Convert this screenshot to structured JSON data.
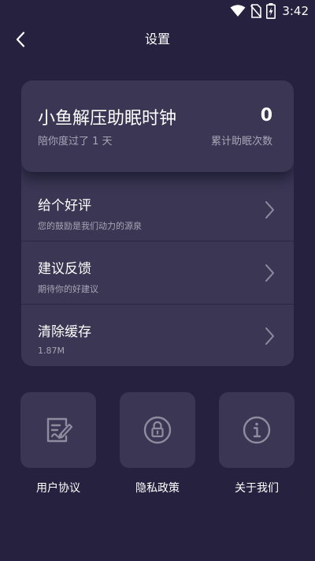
{
  "status_bar": {
    "time": "3:42",
    "icons": [
      "wifi-icon",
      "no-sim-icon",
      "battery-charging-icon"
    ]
  },
  "nav": {
    "back_icon": "chevron-left-icon",
    "title": "设置"
  },
  "hero": {
    "title": "小鱼解压助眠时钟",
    "subtitle": "陪你度过了 1 天",
    "count": "0",
    "count_label": "累计助眠次数"
  },
  "menu": [
    {
      "title": "给个好评",
      "subtitle": "您的鼓励是我们动力的源泉",
      "icon": "chevron-right-icon"
    },
    {
      "title": "建议反馈",
      "subtitle": "期待你的好建议",
      "icon": "chevron-right-icon"
    },
    {
      "title": "清除缓存",
      "subtitle": "1.87M",
      "icon": "chevron-right-icon"
    }
  ],
  "tiles": [
    {
      "label": "用户协议",
      "icon": "agreement-icon"
    },
    {
      "label": "隐私政策",
      "icon": "lock-icon"
    },
    {
      "label": "关于我们",
      "icon": "info-icon"
    }
  ],
  "colors": {
    "background": "#26213f",
    "card": "#3a3653",
    "secondary_text": "#a9a6b8",
    "icon_stroke": "#8f8ca0"
  }
}
